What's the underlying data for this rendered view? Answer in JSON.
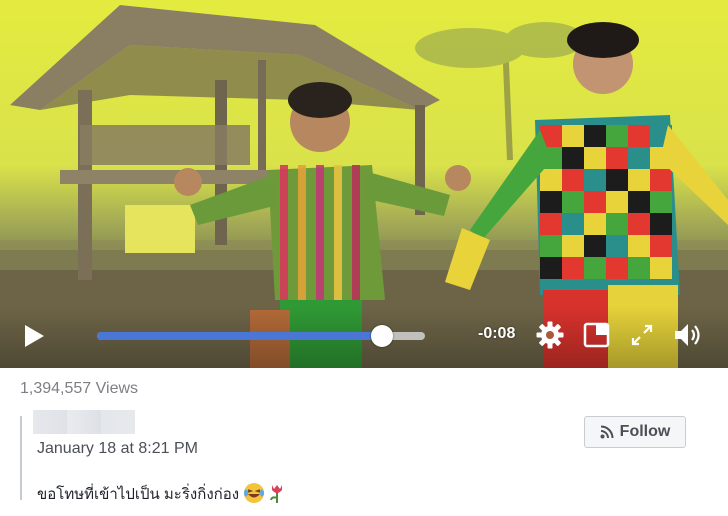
{
  "player": {
    "progress_percent": 87,
    "time_remaining": "-0:08",
    "icons": {
      "play": "play-icon",
      "settings": "gear-icon",
      "pip": "picture-in-picture-icon",
      "fullscreen": "fullscreen-icon",
      "volume": "volume-icon"
    }
  },
  "stats": {
    "views": "1,394,557 Views"
  },
  "post": {
    "date": "January 18 at 8:21 PM",
    "text": "ขอโทษที่เข้าไปเป็น มะริ่งกิ่งก่อง",
    "emojis": [
      "laughing-crying-emoji",
      "tulip-emoji"
    ]
  },
  "follow_button": {
    "label": "Follow",
    "icon": "rss-icon"
  },
  "colors": {
    "progress": "#4a76d6",
    "background_yellow": "#e4eb3f"
  }
}
